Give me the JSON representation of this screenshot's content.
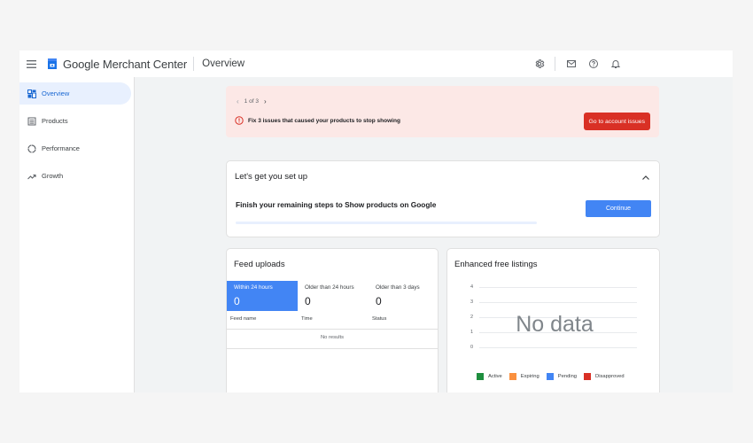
{
  "header": {
    "brand_google": "Google",
    "brand_product": "Merchant Center",
    "breadcrumb": "Overview",
    "icons": [
      "settings-icon",
      "mail-icon",
      "help-icon",
      "notifications-icon"
    ]
  },
  "sidebar": {
    "items": [
      {
        "label": "Overview",
        "icon": "dashboard-icon",
        "active": true
      },
      {
        "label": "Products",
        "icon": "products-icon",
        "active": false
      },
      {
        "label": "Performance",
        "icon": "performance-icon",
        "active": false
      },
      {
        "label": "Growth",
        "icon": "growth-icon",
        "active": false
      }
    ]
  },
  "alert": {
    "pager": "1 of 3",
    "message": "Fix 3 issues that caused your products to stop showing",
    "button": "Go to account issues"
  },
  "setup": {
    "title": "Let's get you set up",
    "subtitle": "Finish your remaining steps to Show products on Google",
    "button": "Continue",
    "progress": 0
  },
  "feed": {
    "title": "Feed uploads",
    "tabs": [
      {
        "label": "Within 24 hours",
        "value": "0",
        "active": true
      },
      {
        "label": "Older than 24 hours",
        "value": "0",
        "active": false
      },
      {
        "label": "Older than 3 days",
        "value": "0",
        "active": false
      }
    ],
    "columns": [
      "Feed name",
      "Time",
      "Status"
    ],
    "empty": "No results"
  },
  "efl": {
    "title": "Enhanced free listings",
    "nodata": "No data",
    "yticks": [
      "4",
      "3",
      "2",
      "1",
      "0"
    ],
    "legend": [
      {
        "label": "Active",
        "color": "#1e8e3e"
      },
      {
        "label": "Expiring",
        "color": "#fa903e"
      },
      {
        "label": "Pending",
        "color": "#4285f4"
      },
      {
        "label": "Disapproved",
        "color": "#d93025"
      }
    ]
  },
  "colors": {
    "accent": "#1a73e8",
    "alert_bg": "#fce8e6",
    "alert_button": "#d93025",
    "primary_button": "#4285f4"
  }
}
